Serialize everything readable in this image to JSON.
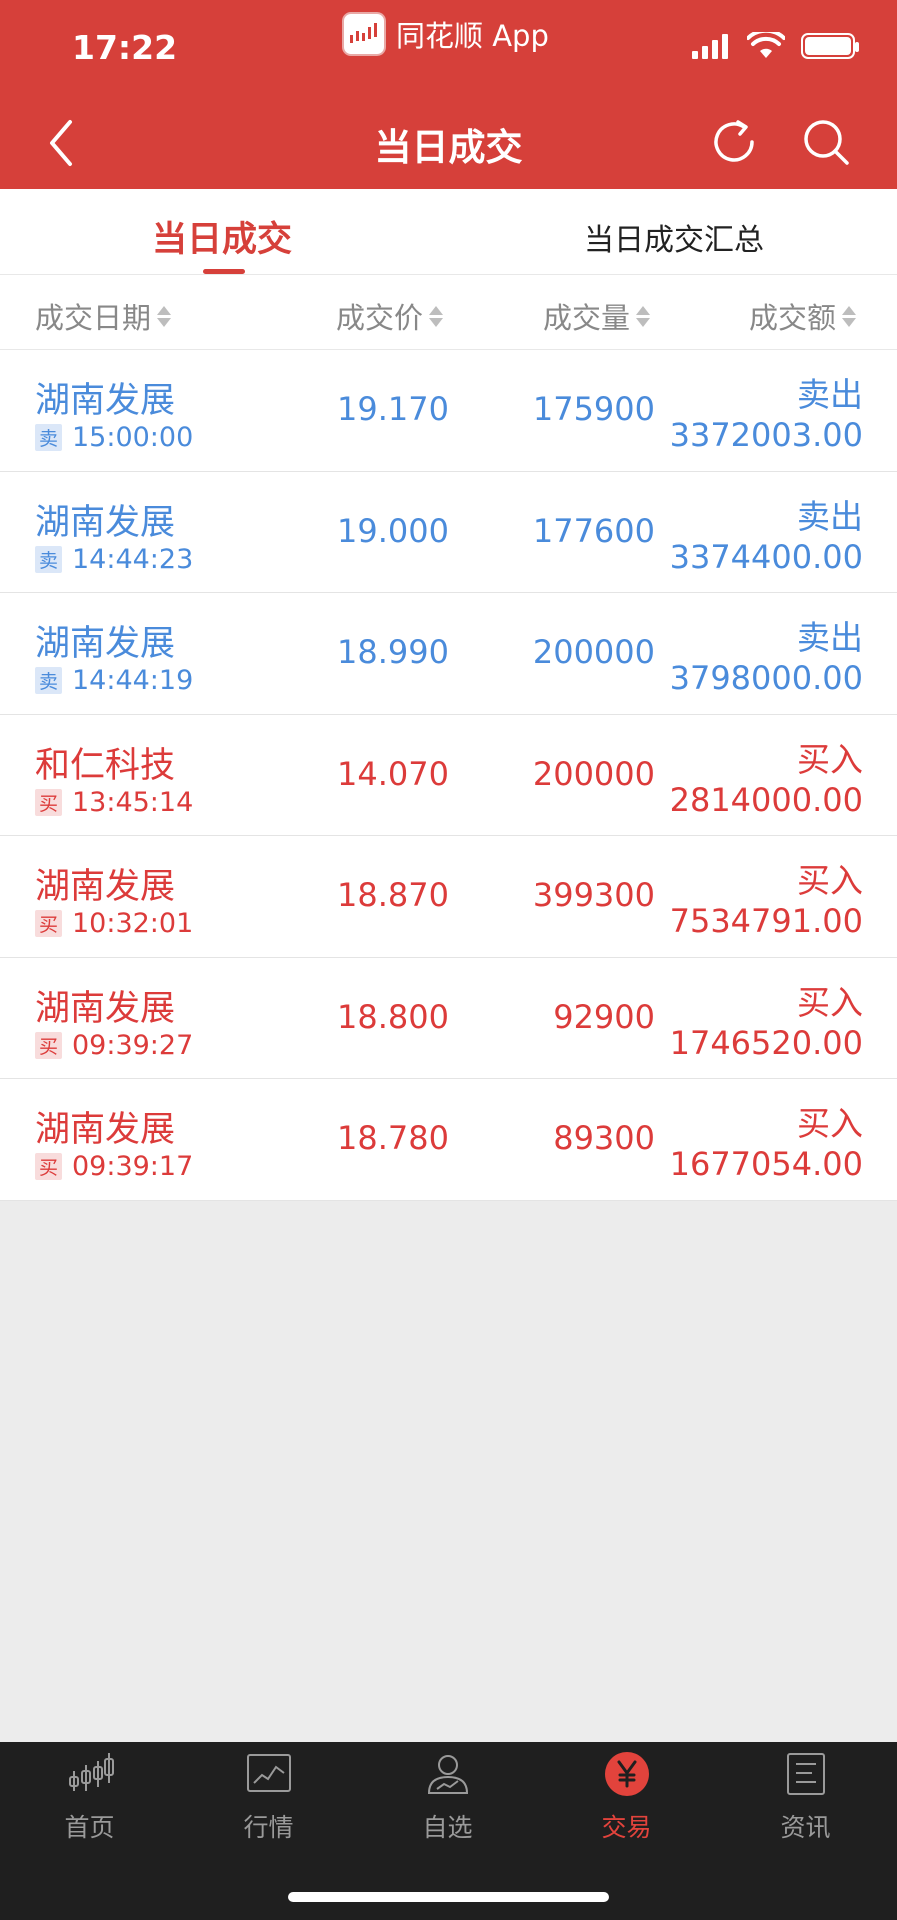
{
  "status": {
    "time": "17:22",
    "app_name": "同花顺 App"
  },
  "nav": {
    "title": "当日成交"
  },
  "tabs": [
    {
      "label": "当日成交",
      "active": true
    },
    {
      "label": "当日成交汇总",
      "active": false
    }
  ],
  "columns": [
    "成交日期",
    "成交价",
    "成交量",
    "成交额"
  ],
  "trades": [
    {
      "name": "湖南发展",
      "badge": "卖",
      "time": "15:00:00",
      "price": "19.170",
      "qty": "175900",
      "action": "卖出",
      "amount": "3372003.00",
      "side": "sell"
    },
    {
      "name": "湖南发展",
      "badge": "卖",
      "time": "14:44:23",
      "price": "19.000",
      "qty": "177600",
      "action": "卖出",
      "amount": "3374400.00",
      "side": "sell"
    },
    {
      "name": "湖南发展",
      "badge": "卖",
      "time": "14:44:19",
      "price": "18.990",
      "qty": "200000",
      "action": "卖出",
      "amount": "3798000.00",
      "side": "sell"
    },
    {
      "name": "和仁科技",
      "badge": "买",
      "time": "13:45:14",
      "price": "14.070",
      "qty": "200000",
      "action": "买入",
      "amount": "2814000.00",
      "side": "buy"
    },
    {
      "name": "湖南发展",
      "badge": "买",
      "time": "10:32:01",
      "price": "18.870",
      "qty": "399300",
      "action": "买入",
      "amount": "7534791.00",
      "side": "buy"
    },
    {
      "name": "湖南发展",
      "badge": "买",
      "time": "09:39:27",
      "price": "18.800",
      "qty": "92900",
      "action": "买入",
      "amount": "1746520.00",
      "side": "buy"
    },
    {
      "name": "湖南发展",
      "badge": "买",
      "time": "09:39:17",
      "price": "18.780",
      "qty": "89300",
      "action": "买入",
      "amount": "1677054.00",
      "side": "buy"
    }
  ],
  "bottom_nav": [
    {
      "label": "首页",
      "icon": "candlestick-icon",
      "active": false
    },
    {
      "label": "行情",
      "icon": "chart-icon",
      "active": false
    },
    {
      "label": "自选",
      "icon": "person-chart-icon",
      "active": false
    },
    {
      "label": "交易",
      "icon": "yen-icon",
      "active": true
    },
    {
      "label": "资讯",
      "icon": "news-icon",
      "active": false
    }
  ],
  "colors": {
    "brand_red": "#d6403a",
    "sell_blue": "#4a8bdb",
    "buy_red": "#dc3b3a"
  }
}
